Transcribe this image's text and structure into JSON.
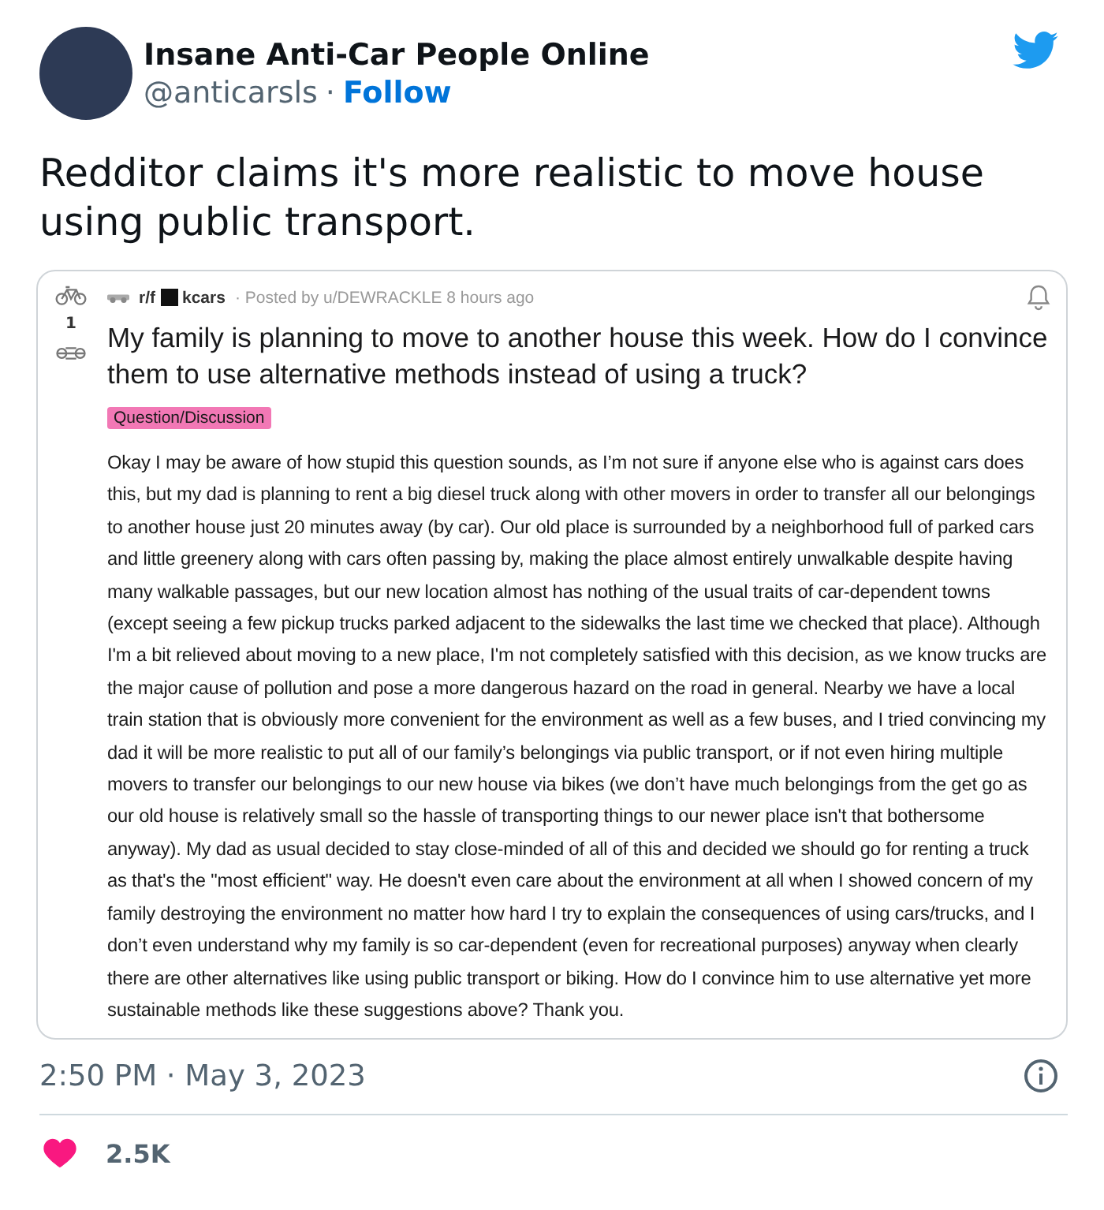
{
  "author": {
    "name": "Insane Anti-Car People Online",
    "handle": "@anticarsls",
    "separator": "·",
    "follow": "Follow"
  },
  "tweet_text": "Redditor claims it's more realistic to move house using public transport.",
  "reddit_post": {
    "subreddit_start": "r/f",
    "subreddit_end": "kcars",
    "meta": "· Posted by u/DEWRACKLE 8 hours ago",
    "votes": "1",
    "title": "My family is planning to move to another house this week. How do I convince them to use alternative methods instead of using a truck?",
    "flair": "Question/Discussion",
    "body": "Okay I may be aware of how stupid this question sounds, as I’m not sure if anyone else who is against cars does this, but my dad is planning to rent a big diesel truck along with other movers in order to transfer all our belongings to another house just 20 minutes away (by car). Our old place is surrounded by a neighborhood full of parked cars and little greenery along with cars often passing by, making the place almost entirely unwalkable despite having many walkable passages, but our new location almost has nothing of the usual traits of car-dependent towns (except seeing a few pickup trucks parked adjacent to the sidewalks the last time we checked that place). Although I'm a bit relieved about moving to a new place, I'm not completely satisfied with this decision, as we know trucks are the major cause of pollution and pose a more dangerous hazard on the road in general. Nearby we have a local train station that is obviously more convenient for the environment as well as a few buses, and I tried convincing my dad it will be more realistic to put all of our family’s belongings via public transport, or if not even hiring multiple movers to transfer our belongings to our new house via bikes (we don’t have much belongings from the get go as our old house is relatively small so the hassle of transporting things to our newer place isn't that bothersome anyway). My dad as usual decided to stay close-minded of all of this and decided we should go for renting a truck as that's the \"most efficient\" way. He doesn't even care about the environment at all when I showed concern of my family destroying the environment no matter how hard I try to explain the consequences of using cars/trucks, and I don’t even understand why my family is so car-dependent (even for recreational purposes) anyway when clearly there are other alternatives like using public transport or biking. How do I convince him to use alternative yet more sustainable methods like these suggestions above? Thank you."
  },
  "timestamp": "2:50 PM · May 3, 2023",
  "likes": "2.5K"
}
